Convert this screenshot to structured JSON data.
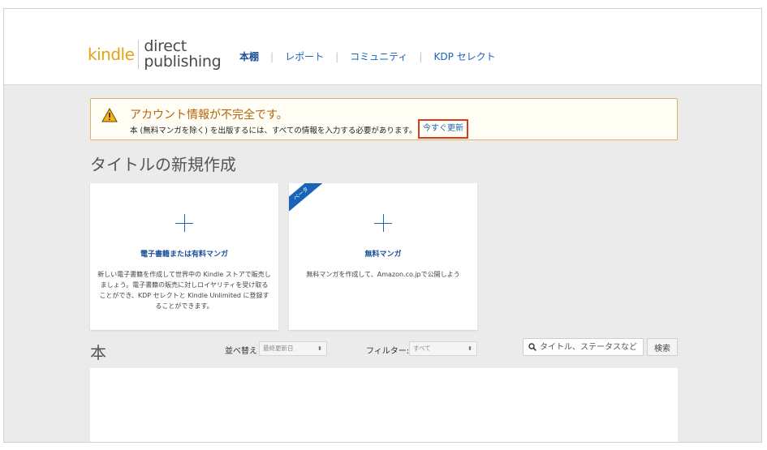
{
  "header": {
    "logo_kindle": "kindle",
    "logo_direct": "direct",
    "logo_publishing": "publishing",
    "nav": [
      {
        "label": "本棚",
        "active": true
      },
      {
        "label": "レポート",
        "active": false
      },
      {
        "label": "コミュニティ",
        "active": false
      },
      {
        "label": "KDP セレクト",
        "active": false
      }
    ]
  },
  "alert": {
    "title": "アカウント情報が不完全です。",
    "message": "本 (無料マンガを除く) を出版するには、すべての情報を入力する必要があります。",
    "link": "今すぐ更新",
    "icon": "warning-icon"
  },
  "new_title": {
    "heading": "タイトルの新規作成",
    "cards": [
      {
        "title": "電子書籍または有料マンガ",
        "description": "新しい電子書籍を作成して世界中の Kindle ストアで販売しましょう。電子書籍の販売に対しロイヤリティを受け取ることができ、KDP セレクトと Kindle Unlimited に登録することができます。"
      },
      {
        "title": "無料マンガ",
        "description": "無料マンガを作成して、Amazon.co.jpで公開しよう",
        "badge": "ベータ"
      }
    ]
  },
  "books": {
    "heading": "本",
    "sort_label": "並べ替え",
    "sort_value": "最終更新日",
    "filter_label": "フィルター:",
    "filter_value": "すべて",
    "search_placeholder": "タイトル、ステータスなど",
    "search_button": "検索"
  },
  "colors": {
    "link_blue": "#1a64b8",
    "logo_orange": "#e6a117",
    "alert_title": "#b5650c",
    "highlight_red": "#d93a1e"
  }
}
